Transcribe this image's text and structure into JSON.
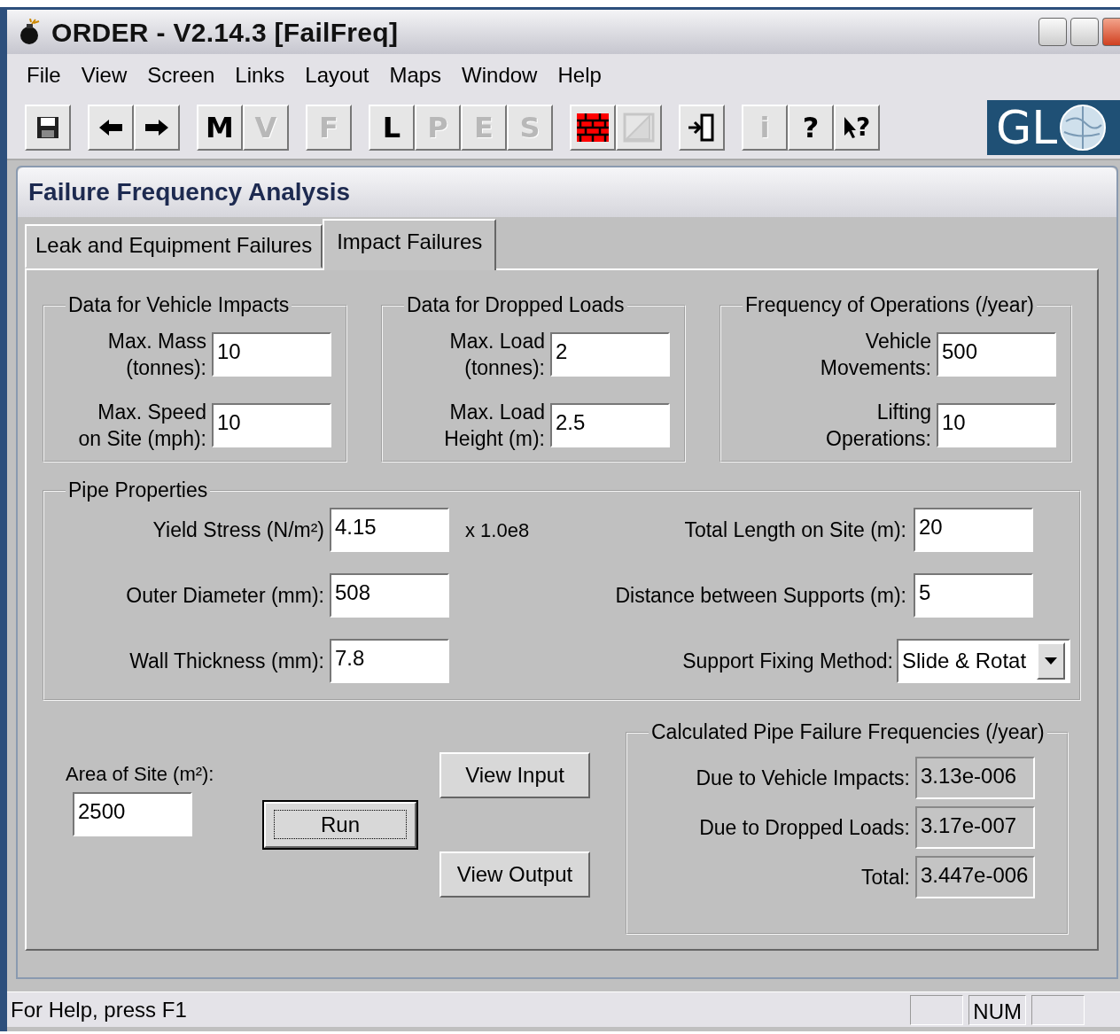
{
  "window": {
    "title": "ORDER - V2.14.3 [FailFreq]"
  },
  "menu": [
    {
      "label": "File"
    },
    {
      "label": "View"
    },
    {
      "label": "Screen"
    },
    {
      "label": "Links"
    },
    {
      "label": "Layout"
    },
    {
      "label": "Maps"
    },
    {
      "label": "Window"
    },
    {
      "label": "Help"
    }
  ],
  "toolbar": [
    [
      {
        "kind": "save",
        "disabled": false
      }
    ],
    [
      {
        "kind": "back",
        "disabled": false
      },
      {
        "kind": "forward",
        "disabled": false
      }
    ],
    [
      {
        "kind": "letter",
        "label": "M",
        "disabled": false
      },
      {
        "kind": "letter",
        "label": "V",
        "disabled": true
      }
    ],
    [
      {
        "kind": "letter",
        "label": "F",
        "disabled": true
      }
    ],
    [
      {
        "kind": "letter",
        "label": "L",
        "disabled": false
      },
      {
        "kind": "letter",
        "label": "P",
        "disabled": true
      },
      {
        "kind": "letter",
        "label": "E",
        "disabled": true
      },
      {
        "kind": "letter",
        "label": "S",
        "disabled": true
      }
    ],
    [
      {
        "kind": "wall",
        "disabled": false
      },
      {
        "kind": "image",
        "disabled": true
      }
    ],
    [
      {
        "kind": "exit",
        "disabled": false
      }
    ],
    [
      {
        "kind": "letter",
        "label": "i",
        "disabled": true
      },
      {
        "kind": "letter",
        "label": "?",
        "disabled": false
      },
      {
        "kind": "pointer_help",
        "label": "?",
        "disabled": false
      }
    ]
  ],
  "logo": {
    "text": "GL"
  },
  "panel": {
    "title": "Failure Frequency Analysis"
  },
  "tabs": [
    {
      "label": "Leak and Equipment Failures",
      "selected": false
    },
    {
      "label": "Impact Failures",
      "selected": true
    }
  ],
  "groups": [
    {
      "title": "Data for Vehicle Impacts",
      "fields": [
        {
          "label": "Max. Mass\n(tonnes):",
          "value": "10"
        },
        {
          "label": "Max. Speed\non Site (mph):",
          "value": "10"
        }
      ]
    },
    {
      "title": "Data for Dropped Loads",
      "fields": [
        {
          "label": "Max. Load\n(tonnes):",
          "value": "2"
        },
        {
          "label": "Max. Load\nHeight (m):",
          "value": "2.5"
        }
      ]
    },
    {
      "title": "Frequency of Operations (/year)",
      "fields": [
        {
          "label": "Vehicle\nMovements:",
          "value": "500"
        },
        {
          "label": "Lifting\nOperations:",
          "value": "10"
        }
      ]
    }
  ],
  "pipe": {
    "title": "Pipe Properties",
    "left": [
      {
        "label": "Yield Stress (N/m²)",
        "value": "4.15",
        "unit": "x 1.0e8"
      },
      {
        "label": "Outer Diameter (mm):",
        "value": "508"
      },
      {
        "label": "Wall Thickness (mm):",
        "value": "7.8"
      }
    ],
    "right": [
      {
        "kind": "text",
        "label": "Total Length on Site (m):",
        "value": "20"
      },
      {
        "kind": "text",
        "label": "Distance between Supports (m):",
        "value": "5"
      },
      {
        "kind": "dropdown",
        "label": "Support Fixing Method:",
        "value": "Slide & Rotat"
      }
    ]
  },
  "site_area": {
    "label": "Area of Site (m²):",
    "value": "2500"
  },
  "buttons": [
    {
      "kind": "view_input",
      "label": "View Input",
      "focused": false
    },
    {
      "kind": "run",
      "label": "Run",
      "focused": true
    },
    {
      "kind": "view_output",
      "label": "View Output",
      "focused": false
    }
  ],
  "results": {
    "title": "Calculated Pipe Failure Frequencies (/year)",
    "rows": [
      {
        "label": "Due to Vehicle Impacts:",
        "value": "3.13e-006"
      },
      {
        "label": "Due to Dropped Loads:",
        "value": "3.17e-007"
      },
      {
        "label": "Total:",
        "value": "3.447e-006"
      }
    ]
  },
  "status_bar": {
    "text": "For Help, press F1",
    "panels": [
      {
        "kind": "empty"
      },
      {
        "kind": "text",
        "text": "NUM"
      },
      {
        "kind": "empty"
      }
    ]
  }
}
